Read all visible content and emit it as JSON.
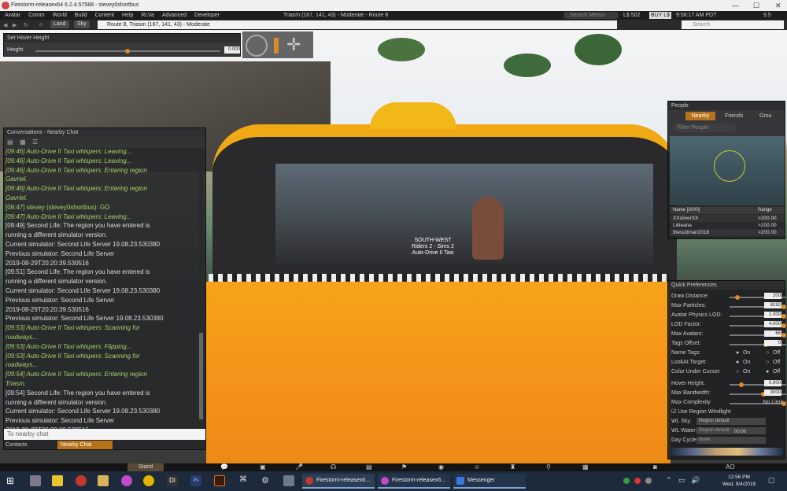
{
  "window": {
    "title": "Firestorm-releasex64 6.2.4.57588 - stevey0shortbus"
  },
  "menu": {
    "items": [
      "Avatar",
      "Comm",
      "World",
      "Build",
      "Content",
      "Help",
      "RLVa",
      "Advanced",
      "Developer"
    ],
    "location": "Triasm (167, 141, 43) - Moderate - Route 8",
    "search_placeholder": "Search Menus",
    "balance": "L$ 502",
    "buy": "BUY L$",
    "time": "9:56:17 AM PDT",
    "fps": "9.5"
  },
  "nav": {
    "land": "Land",
    "sky": "Sky",
    "location_field": "Route 8, Triasm (167, 141, 43) - Moderate",
    "search_placeholder": "Search"
  },
  "hover": {
    "title": "Set Hover Height",
    "label": "Height",
    "value": "0.000"
  },
  "conversations": {
    "title": "Conversations - Nearby Chat",
    "lines": [
      {
        "text": "[09:46] Auto-Drive II Taxi whispers: Leaving...",
        "style": "i"
      },
      {
        "text": "[09:46] Auto-Drive II Taxi whispers: Leaving...",
        "style": "i"
      },
      {
        "text": "[09:46] Auto-Drive II Taxi whispers: Entering region",
        "style": "i"
      },
      {
        "text": "Gavriel.",
        "style": "i"
      },
      {
        "text": "[09:46] Auto-Drive II Taxi whispers: Entering region",
        "style": "i"
      },
      {
        "text": "Gavriel.",
        "style": "i"
      },
      {
        "text": "[09:47] stevey (stevey0shortbus): GO",
        "style": "g"
      },
      {
        "text": "[09:47] Auto-Drive II Taxi whispers: Leaving...",
        "style": "i"
      },
      {
        "text": "[09:49] Second Life: The region you have entered is",
        "style": ""
      },
      {
        "text": "running a different simulator version.",
        "style": ""
      },
      {
        "text": "Current simulator: Second Life Server 19.08.23.530380",
        "style": ""
      },
      {
        "text": "Previous simulator: Second Life Server",
        "style": ""
      },
      {
        "text": "2019-08-29T20:20:39.530516",
        "style": ""
      },
      {
        "text": "[09:51] Second Life: The region you have entered is",
        "style": ""
      },
      {
        "text": "running a different simulator version.",
        "style": ""
      },
      {
        "text": "Current simulator: Second Life Server 19.08.23.530380",
        "style": ""
      },
      {
        "text": "Previous simulator: Second Life Server",
        "style": ""
      },
      {
        "text": "2019-08-29T20:20:39.530516",
        "style": ""
      },
      {
        "text": "Previous simulator: Second Life Server 19.08.23.530380",
        "style": ""
      },
      {
        "text": "[09:53] Auto-Drive II Taxi whispers: Scanning for",
        "style": "i"
      },
      {
        "text": "roadways...",
        "style": "i"
      },
      {
        "text": "[09:53] Auto-Drive II Taxi whispers: Flipping...",
        "style": "i"
      },
      {
        "text": "[09:53] Auto-Drive II Taxi whispers: Scanning for",
        "style": "i"
      },
      {
        "text": "roadways...",
        "style": "i"
      },
      {
        "text": "[09:54] Auto-Drive II Taxi whispers: Entering region",
        "style": "i"
      },
      {
        "text": "Triasm.",
        "style": "i"
      },
      {
        "text": "[09:54] Second Life: The region you have entered is",
        "style": ""
      },
      {
        "text": "running a different simulator version.",
        "style": ""
      },
      {
        "text": "Current simulator: Second Life Server 19.08.23.530380",
        "style": ""
      },
      {
        "text": "Previous simulator: Second Life Server",
        "style": ""
      },
      {
        "text": "2019-08-29T20:20:39.530516",
        "style": ""
      }
    ],
    "input_placeholder": "To nearby chat",
    "tab_contacts": "Contacts",
    "tab_nearby": "Nearby Chat"
  },
  "taxi_label": {
    "line1": "SOUTH-WEST",
    "line2": "Riders 2 - Sims 2",
    "line3": "Auto-Drive II Taxi"
  },
  "people": {
    "title": "People",
    "tabs": [
      "Nearby",
      "Friends",
      "Grou"
    ],
    "filter_placeholder": "Filter People",
    "col_name": "Name [3/0/0]",
    "col_range": "Range",
    "rows": [
      {
        "name": "XXsilverXX",
        "range": ">200.00"
      },
      {
        "name": "Lillieana",
        "range": ">200.00"
      },
      {
        "name": "thesuitman2018",
        "range": ">200.00"
      }
    ]
  },
  "quickprefs": {
    "title": "Quick Preferences",
    "sliders": [
      {
        "label": "Draw Distance:",
        "value": "200",
        "level": 0.1
      },
      {
        "label": "Max Particles:",
        "value": "8192",
        "level": 1.0
      },
      {
        "label": "Avatar Physics LOD:",
        "value": "1.000",
        "level": 1.0
      },
      {
        "label": "LOD Factor:",
        "value": "4.000",
        "level": 1.0
      },
      {
        "label": "Max Avatars:",
        "value": "66",
        "level": 1.0
      },
      {
        "label": "Tags Offset:",
        "value": "0",
        "level": 0.65
      }
    ],
    "radios": [
      {
        "label": "Name Tags:",
        "on": "On",
        "off": "Off",
        "selected": "on"
      },
      {
        "label": "LookAt Target:",
        "on": "On",
        "off": "Off",
        "selected": "on"
      },
      {
        "label": "Color Under Cursor:",
        "on": "On",
        "off": "Off",
        "selected": "off"
      }
    ],
    "hover_height": {
      "label": "Hover Height:",
      "value": "0.000"
    },
    "max_bandwidth": {
      "label": "Max Bandwidth:",
      "value": "3000"
    },
    "max_complexity": {
      "label": "Max Complexity",
      "value": "No Limit"
    },
    "windlight": "Use Region Windlight",
    "wl_sky": {
      "label": "WL Sky:",
      "value": "Region default"
    },
    "wl_water": {
      "label": "WL Water:",
      "value": "Region default"
    },
    "day_cycle": {
      "label": "Day Cycle:",
      "value": "None"
    },
    "time": "00:00"
  },
  "bottom": {
    "stand": "Stand",
    "ao": "AO"
  },
  "taskbar": {
    "items": [
      "Firestorm-releasex6...",
      "Firestorm-releasex6...",
      "Messenger"
    ],
    "clock_time": "12:56 PM",
    "clock_date": "Wed, 9/4/2019"
  }
}
